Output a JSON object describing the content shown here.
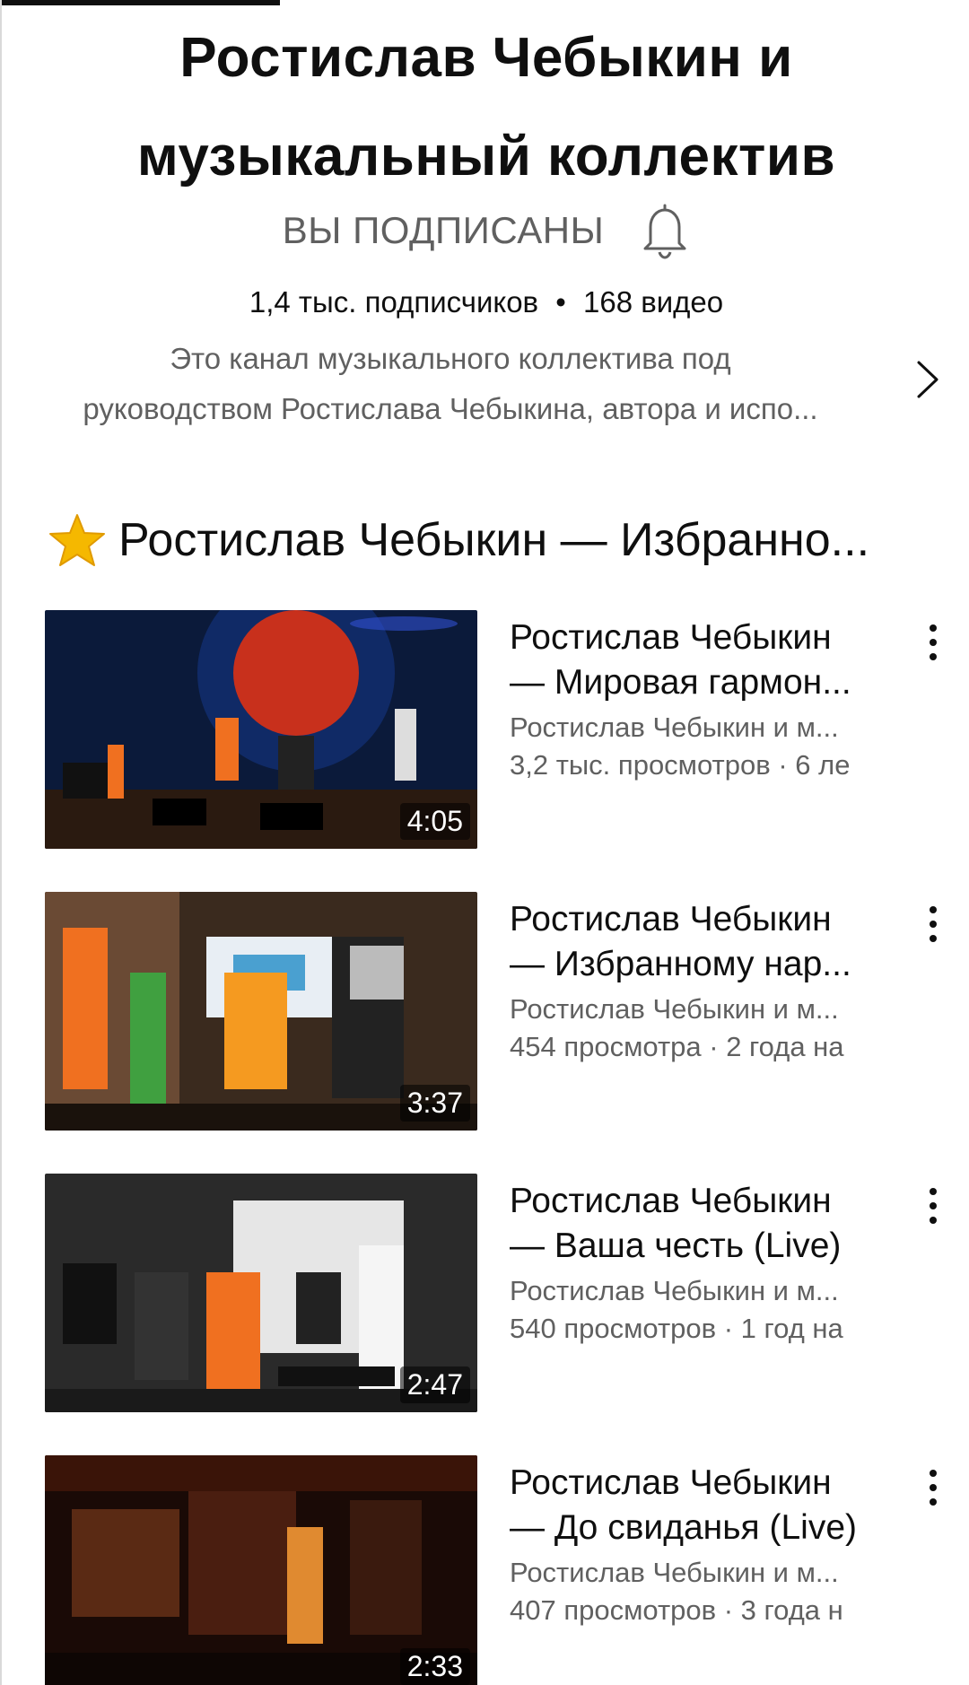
{
  "channel": {
    "name_line1": "Ростислав Чебыкин и",
    "name_line2": "музыкальный коллектив",
    "subscribed_label": "ВЫ ПОДПИСАНЫ",
    "subscribers": "1,4 тыс. подписчиков",
    "separator": "•",
    "videos_count": "168 видео",
    "description_line1": "Это канал музыкального коллектива под",
    "description_line2": "руководством Ростислава Чебыкина, автора и испо..."
  },
  "section": {
    "icon": "star-icon",
    "title": "Ростислав Чебыкин — Избранно..."
  },
  "videos": [
    {
      "title_line1": "Ростислав Чебыкин",
      "title_line2": "— Мировая гармон...",
      "channel": "Ростислав Чебыкин и м...",
      "stats": "3,2 тыс. просмотров · 6 ле",
      "duration": "4:05"
    },
    {
      "title_line1": "Ростислав Чебыкин",
      "title_line2": "— Избранному нар...",
      "channel": "Ростислав Чебыкин и м...",
      "stats": "454 просмотра · 2 года на",
      "duration": "3:37"
    },
    {
      "title_line1": "Ростислав Чебыкин",
      "title_line2": "— Ваша честь (Live)",
      "channel": "Ростислав Чебыкин и м...",
      "stats": "540 просмотров · 1 год на",
      "duration": "2:47"
    },
    {
      "title_line1": "Ростислав Чебыкин",
      "title_line2": "— До свиданья (Live)",
      "channel": "Ростислав Чебыкин и м...",
      "stats": "407 просмотров · 3 года н",
      "duration": "2:33"
    }
  ],
  "colors": {
    "text_primary": "#0f0f0f",
    "text_secondary": "#606060",
    "star": "#f5b800"
  }
}
